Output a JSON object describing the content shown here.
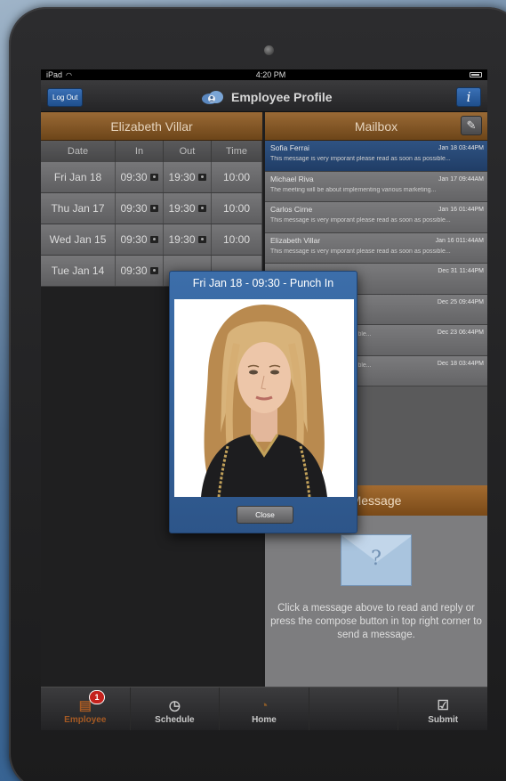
{
  "statusbar": {
    "device": "iPad",
    "time": "4:20 PM"
  },
  "navbar": {
    "logout_label": "Log Out",
    "title": "Employee Profile",
    "info_label": "i"
  },
  "left": {
    "employee_name": "Elizabeth Villar",
    "columns": [
      "Date",
      "In",
      "Out",
      "Time"
    ],
    "rows": [
      {
        "date": "Fri Jan 18",
        "in": "09:30",
        "out": "19:30",
        "time": "10:00"
      },
      {
        "date": "Thu Jan 17",
        "in": "09:30",
        "out": "19:30",
        "time": "10:00"
      },
      {
        "date": "Wed Jan 15",
        "in": "09:30",
        "out": "19:30",
        "time": "10:00"
      },
      {
        "date": "Tue Jan 14",
        "in": "09:30",
        "out": "",
        "time": ""
      }
    ]
  },
  "mailbox": {
    "title": "Mailbox",
    "items": [
      {
        "from": "Sofia Ferrai",
        "time": "Jan 18 03:44PM",
        "preview": "This message is very imporant please read as soon as possible...",
        "selected": true
      },
      {
        "from": "Michael Riva",
        "time": "Jan 17 09:44AM",
        "preview": "The meeting will be about implementing various marketing..."
      },
      {
        "from": "Carlos Cirne",
        "time": "Jan 16 01:44PM",
        "preview": "This message is very imporant please read as soon as possible..."
      },
      {
        "from": "Elizabeth Villar",
        "time": "Jan 16 011:44AM",
        "preview": "This message is very imporant please read as soon as possible..."
      },
      {
        "from": "",
        "time": "Dec 31 11:44PM",
        "preview": ""
      },
      {
        "from": "",
        "time": "Dec 25 09:44PM",
        "preview": ""
      },
      {
        "from": "",
        "time": "Dec 23 06:44PM",
        "preview": "nt please read as soon as possible..."
      },
      {
        "from": "",
        "time": "Dec 18 03:44PM",
        "preview": "nt please read as soon as possible..."
      }
    ]
  },
  "message": {
    "title": "Message",
    "hint": "Click a message above to read and reply or press the compose button in top right corner to send a message."
  },
  "tabs": [
    {
      "label": "Employee",
      "icon": "id-card-icon",
      "badge": "1",
      "active": true
    },
    {
      "label": "Schedule",
      "icon": "clock-icon"
    },
    {
      "label": "Home",
      "icon": "home-icon"
    },
    {
      "label": "",
      "icon": ""
    },
    {
      "label": "Submit",
      "icon": "checkbox-icon"
    }
  ],
  "popup": {
    "title": "Fri Jan 18 - 09:30 - Punch In",
    "close_label": "Close"
  },
  "colors": {
    "accent_brown": "#8a5a28",
    "accent_blue": "#2f5d98",
    "badge_red": "#c4221d"
  }
}
